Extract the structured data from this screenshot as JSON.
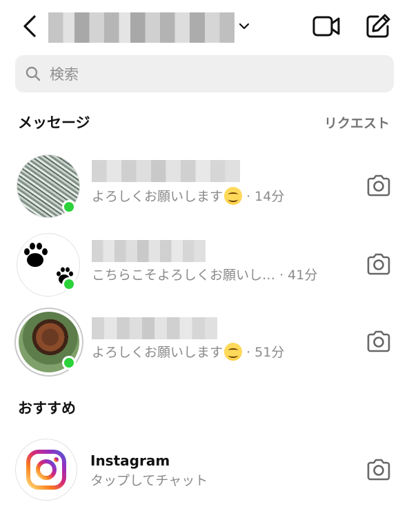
{
  "header": {
    "back_icon": "chevron-left-icon",
    "account_chevron_icon": "chevron-down-icon",
    "video_icon": "video-camera-icon",
    "compose_icon": "compose-icon"
  },
  "search": {
    "placeholder": "検索",
    "icon": "search-icon"
  },
  "sections": {
    "messages_heading": "メッセージ",
    "requests_label": "リクエスト",
    "suggested_heading": "おすすめ"
  },
  "conversations": [
    {
      "preview": "よろしくお願いします",
      "has_emoji": true,
      "time": "· 14分",
      "online": true
    },
    {
      "preview": "こちらこそよろしくお願いし…",
      "has_emoji": false,
      "time": "· 41分",
      "online": true
    },
    {
      "preview": "よろしくお願いします",
      "has_emoji": true,
      "time": "· 51分",
      "online": true
    }
  ],
  "suggested": [
    {
      "name": "Instagram",
      "subtitle": "タップしてチャット"
    }
  ],
  "colors": {
    "online": "#2bd23a",
    "secondary_text": "#8a8a8a",
    "search_bg": "#efefef"
  }
}
